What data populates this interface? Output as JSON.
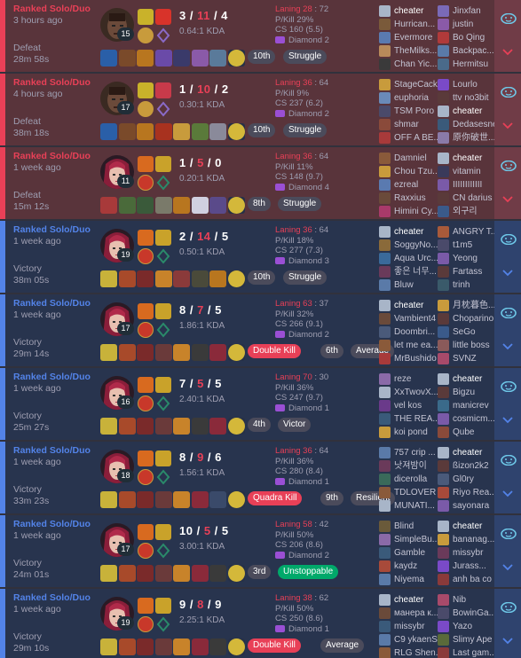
{
  "colors": {
    "loss": "#e84057",
    "win": "#5383e8",
    "loss_bg": "#59343b",
    "win_bg": "#28344e"
  },
  "games": [
    {
      "result": "loss",
      "queue": "Ranked Solo/Duo",
      "ago": "3 hours ago",
      "outcome": "Defeat",
      "duration": "28m 58s",
      "level": "15",
      "kills": "3",
      "deaths": "11",
      "assists": "4",
      "kda": "0.64:1 KDA",
      "champ": "dark",
      "laning": "Laning 28",
      "laning_opp": " : 72",
      "pkill": "P/Kill 29%",
      "cs": "CS 160 (5.5)",
      "rank": "Diamond 2",
      "placement": "10th",
      "chips": [
        {
          "text": "Struggle",
          "type": "tag"
        }
      ],
      "items": [
        "#2a5fa8",
        "#7a4a2a",
        "#b8761f",
        "#6a4aa8",
        "#3a3a6a",
        "#8a5aa8",
        "#5a7a9a",
        "#2a2a3a"
      ],
      "ward": "#d4b83a",
      "spells": [
        "#c9b22a",
        "#d8332a"
      ],
      "runes": [
        "#c89b3c",
        "#8a6ac8"
      ],
      "blue": [
        {
          "name": "cheater",
          "icon": "#a8b5c8"
        },
        {
          "name": "Hurrican...",
          "icon": "#7a5a3a"
        },
        {
          "name": "Evermore",
          "icon": "#5a7ab0"
        },
        {
          "name": "TheMilks...",
          "icon": "#b88a5a"
        },
        {
          "name": "Chan Yic...",
          "icon": "#3a3a3a"
        }
      ],
      "red": [
        {
          "name": "Jinxfan",
          "icon": "#7a6ab8"
        },
        {
          "name": "justin",
          "icon": "#8a5aa8"
        },
        {
          "name": "Bo Qing",
          "icon": "#b03a3a"
        },
        {
          "name": "Backpac...",
          "icon": "#5a7aa8"
        },
        {
          "name": "Hermitsu",
          "icon": "#4a6a8a"
        }
      ]
    },
    {
      "result": "loss",
      "queue": "Ranked Solo/Duo",
      "ago": "4 hours ago",
      "outcome": "Defeat",
      "duration": "38m 18s",
      "level": "17",
      "kills": "1",
      "deaths": "10",
      "assists": "2",
      "kda": "0.30:1 KDA",
      "champ": "dark",
      "laning": "Laning 36",
      "laning_opp": " : 64",
      "pkill": "P/Kill 9%",
      "cs": "CS 237 (6.2)",
      "rank": "Diamond 2",
      "placement": "10th",
      "chips": [
        {
          "text": "Struggle",
          "type": "tag"
        }
      ],
      "items": [
        "#2a5fa8",
        "#7a4a2a",
        "#b8761f",
        "#a8321f",
        "#c89b3c",
        "#5a7a3a",
        "#8a8a9a",
        "#2a2a3a"
      ],
      "ward": "#d4b83a",
      "spells": [
        "#c9b22a",
        "#c83a4a"
      ],
      "runes": [
        "#c89b3c",
        "#8a6ac8"
      ],
      "blue": [
        {
          "name": "StageCack",
          "icon": "#c89b3c"
        },
        {
          "name": "euphoria",
          "icon": "#6a8ab8"
        },
        {
          "name": "TSM Poro",
          "icon": "#4a4a6a"
        },
        {
          "name": "shmar",
          "icon": "#8a4a3a"
        },
        {
          "name": "OFF A BE...",
          "icon": "#a83a3a"
        }
      ],
      "red": [
        {
          "name": "Lourlo",
          "icon": "#7a4ac8"
        },
        {
          "name": "ttv no3bit",
          "icon": "#5a3a3a"
        },
        {
          "name": "cheater",
          "icon": "#a8b5c8"
        },
        {
          "name": "Dedasesne",
          "icon": "#3a5a7a"
        },
        {
          "name": "原你破世...",
          "icon": "#8a7aa8"
        }
      ]
    },
    {
      "result": "loss",
      "queue": "Ranked Solo/Duo",
      "ago": "1 week ago",
      "outcome": "Defeat",
      "duration": "15m 12s",
      "level": "11",
      "kills": "1",
      "deaths": "5",
      "assists": "0",
      "kda": "0.20:1 KDA",
      "champ": "pink",
      "laning": "Laning 36",
      "laning_opp": " : 64",
      "pkill": "P/Kill 11%",
      "cs": "CS 148 (9.7)",
      "rank": "Diamond 4",
      "placement": "8th",
      "chips": [
        {
          "text": "Struggle",
          "type": "tag"
        }
      ],
      "items": [
        "#a83a3a",
        "#4a6a3a",
        "#3a5a3a",
        "#7a7a6a",
        "#b8761f",
        "#d0d0e0",
        "#5a4a8a",
        "#2a2a3a"
      ],
      "ward": "#d4b83a",
      "spells": [
        "#d86a1f",
        "#c9a22a"
      ],
      "runes": [
        "#c8382a",
        "#2a8a6a"
      ],
      "blue": [
        {
          "name": "Damniel",
          "icon": "#8a5a3a"
        },
        {
          "name": "Chou Tzu...",
          "icon": "#c89b3c"
        },
        {
          "name": "ezreal",
          "icon": "#5a7ab0"
        },
        {
          "name": "Raxxius",
          "icon": "#6a4a3a"
        },
        {
          "name": "Himini Cy...",
          "icon": "#a83a6a"
        }
      ],
      "red": [
        {
          "name": "cheater",
          "icon": "#a8b5c8"
        },
        {
          "name": "vitamin",
          "icon": "#3a3a5a"
        },
        {
          "name": "IIIIIIIIIIII",
          "icon": "#7a5aa8"
        },
        {
          "name": "CN darius",
          "icon": "#5a3a3a"
        },
        {
          "name": "외구리",
          "icon": "#3a5a8a"
        }
      ]
    },
    {
      "result": "win",
      "queue": "Ranked Solo/Duo",
      "ago": "1 week ago",
      "outcome": "Victory",
      "duration": "38m 05s",
      "level": "19",
      "kills": "2",
      "deaths": "14",
      "assists": "5",
      "kda": "0.50:1 KDA",
      "champ": "pink",
      "laning": "Laning 36",
      "laning_opp": " : 64",
      "pkill": "P/Kill 18%",
      "cs": "CS 277 (7.3)",
      "rank": "Diamond 3",
      "placement": "10th",
      "chips": [
        {
          "text": "Struggle",
          "type": "tag"
        }
      ],
      "items": [
        "#c8b23a",
        "#a84a2a",
        "#7a2a2a",
        "#c8832a",
        "#8a3a3a",
        "#4a4a3a",
        "#b8761f",
        "#2a2a3a"
      ],
      "ward": "#d4b83a",
      "spells": [
        "#d86a1f",
        "#c9a22a"
      ],
      "runes": [
        "#c8382a",
        "#2a8a6a"
      ],
      "blue": [
        {
          "name": "cheater",
          "icon": "#a8b5c8"
        },
        {
          "name": "SoggyNo...",
          "icon": "#8a6a3a"
        },
        {
          "name": "Aqua Urc...",
          "icon": "#3a6a9a"
        },
        {
          "name": "좋은 너무...",
          "icon": "#6a3a5a"
        },
        {
          "name": "Bluw",
          "icon": "#5a7aa8"
        }
      ],
      "red": [
        {
          "name": "ANGRY T...",
          "icon": "#a85a3a"
        },
        {
          "name": "t1m5",
          "icon": "#4a4a6a"
        },
        {
          "name": "Yeong",
          "icon": "#7a5aa8"
        },
        {
          "name": "Fartass",
          "icon": "#5a3a3a"
        },
        {
          "name": "trinh",
          "icon": "#3a5a6a"
        }
      ]
    },
    {
      "result": "win",
      "queue": "Ranked Solo/Duo",
      "ago": "1 week ago",
      "outcome": "Victory",
      "duration": "29m 14s",
      "level": "17",
      "kills": "8",
      "deaths": "7",
      "assists": "5",
      "kda": "1.86:1 KDA",
      "champ": "pink",
      "laning": "Laning 63",
      "laning_opp": " : 37",
      "pkill": "P/Kill 32%",
      "cs": "CS 266 (9.1)",
      "rank": "Diamond 2",
      "placement": "6th",
      "chips": [
        {
          "text": "Double Kill",
          "type": "kill"
        },
        {
          "text": "Average",
          "type": "tag"
        }
      ],
      "items": [
        "#c8b23a",
        "#a84a2a",
        "#7a2a2a",
        "#6a3a3a",
        "#c8832a",
        "#3a3a3a",
        "#8a2a3a",
        "#2a2a3a"
      ],
      "ward": "#d4b83a",
      "spells": [
        "#d86a1f",
        "#c9a22a"
      ],
      "runes": [
        "#c8382a",
        "#2a8a6a"
      ],
      "blue": [
        {
          "name": "cheater",
          "icon": "#a8b5c8"
        },
        {
          "name": "Vambient4",
          "icon": "#6a4a3a"
        },
        {
          "name": "Doombri...",
          "icon": "#4a5a7a"
        },
        {
          "name": "let me ea...",
          "icon": "#8a5a3a"
        },
        {
          "name": "MrBushido",
          "icon": "#a83a3a"
        }
      ],
      "red": [
        {
          "name": "月枕暮色...",
          "icon": "#c89b3c"
        },
        {
          "name": "Choparino",
          "icon": "#5a3a3a"
        },
        {
          "name": "SeGo",
          "icon": "#3a5a8a"
        },
        {
          "name": "little boss",
          "icon": "#8a5a5a"
        },
        {
          "name": "SVNZ",
          "icon": "#a84a6a"
        }
      ]
    },
    {
      "result": "win",
      "queue": "Ranked Solo/Duo",
      "ago": "1 week ago",
      "outcome": "Victory",
      "duration": "25m 27s",
      "level": "16",
      "kills": "7",
      "deaths": "5",
      "assists": "5",
      "kda": "2.40:1 KDA",
      "champ": "pink",
      "laning": "Laning 70",
      "laning_opp": " : 30",
      "pkill": "P/Kill 36%",
      "cs": "CS 247 (9.7)",
      "rank": "Diamond 1",
      "placement": "4th",
      "chips": [
        {
          "text": "Victor",
          "type": "tag"
        }
      ],
      "items": [
        "#c8b23a",
        "#a84a2a",
        "#7a2a2a",
        "#6a3a3a",
        "#c8832a",
        "#3a3a3a",
        "#8a2a3a",
        "#2a2a3a"
      ],
      "ward": "#d4b83a",
      "spells": [
        "#d86a1f",
        "#c9a22a"
      ],
      "runes": [
        "#c8382a",
        "#2a8a6a"
      ],
      "blue": [
        {
          "name": "reze",
          "icon": "#8a6aa8"
        },
        {
          "name": "XxTwovX...",
          "icon": "#a8b5c8"
        },
        {
          "name": "vel kos",
          "icon": "#6a3a8a"
        },
        {
          "name": "THE REA...",
          "icon": "#3a5a7a"
        },
        {
          "name": "koi pond",
          "icon": "#c89b3c"
        }
      ],
      "red": [
        {
          "name": "cheater",
          "icon": "#a8b5c8"
        },
        {
          "name": "Bigzu",
          "icon": "#5a3a3a"
        },
        {
          "name": "manicrev",
          "icon": "#3a6a8a"
        },
        {
          "name": "cosmicm...",
          "icon": "#7a5aa8"
        },
        {
          "name": "Qube",
          "icon": "#8a4a3a"
        }
      ]
    },
    {
      "result": "win",
      "queue": "Ranked Solo/Duo",
      "ago": "1 week ago",
      "outcome": "Victory",
      "duration": "33m 23s",
      "level": "18",
      "kills": "8",
      "deaths": "9",
      "assists": "6",
      "kda": "1.56:1 KDA",
      "champ": "pink",
      "laning": "Laning 36",
      "laning_opp": " : 64",
      "pkill": "P/Kill 36%",
      "cs": "CS 280 (8.4)",
      "rank": "Diamond 1",
      "placement": "9th",
      "chips": [
        {
          "text": "Quadra Kill",
          "type": "kill"
        },
        {
          "text": "Resilient",
          "type": "tag"
        }
      ],
      "items": [
        "#c8b23a",
        "#a84a2a",
        "#7a2a2a",
        "#6a3a3a",
        "#c8832a",
        "#8a2a3a",
        "#3a4a6a",
        "#2a2a3a"
      ],
      "ward": "#d4b83a",
      "spells": [
        "#d86a1f",
        "#c9a22a"
      ],
      "runes": [
        "#c8382a",
        "#2a8a6a"
      ],
      "blue": [
        {
          "name": "757 crip ...",
          "icon": "#5a7aa8"
        },
        {
          "name": "낫져밤이",
          "icon": "#6a3a5a"
        },
        {
          "name": "dicerolla",
          "icon": "#3a6a5a"
        },
        {
          "name": "TDLOVER",
          "icon": "#8a5a3a"
        },
        {
          "name": "MUNATI...",
          "icon": "#a8b5c8"
        }
      ],
      "red": [
        {
          "name": "cheater",
          "icon": "#a8b5c8"
        },
        {
          "name": "ßizon2k2",
          "icon": "#5a3a3a"
        },
        {
          "name": "Gl0ry",
          "icon": "#4a5a7a"
        },
        {
          "name": "Riyo Rea...",
          "icon": "#a84a3a"
        },
        {
          "name": "sayonara",
          "icon": "#7a5aa8"
        }
      ]
    },
    {
      "result": "win",
      "queue": "Ranked Solo/Duo",
      "ago": "1 week ago",
      "outcome": "Victory",
      "duration": "24m 01s",
      "level": "17",
      "kills": "10",
      "deaths": "5",
      "assists": "5",
      "kda": "3.00:1 KDA",
      "champ": "pink",
      "laning": "Laning 58",
      "laning_opp": " : 42",
      "pkill": "P/Kill 50%",
      "cs": "CS 206 (8.6)",
      "rank": "Diamond 2",
      "placement": "3rd",
      "chips": [
        {
          "text": "Unstoppable",
          "type": "good"
        }
      ],
      "items": [
        "#c8b23a",
        "#a84a2a",
        "#7a2a2a",
        "#6a3a3a",
        "#c8832a",
        "#8a2a3a",
        "#3a3a3a",
        "#2a2a3a"
      ],
      "ward": "#d4b83a",
      "spells": [
        "#d86a1f",
        "#c9a22a"
      ],
      "runes": [
        "#c8382a",
        "#2a8a6a"
      ],
      "blue": [
        {
          "name": "Blind",
          "icon": "#6a5a3a"
        },
        {
          "name": "SimpleBu...",
          "icon": "#8a6aa8"
        },
        {
          "name": "Gamble",
          "icon": "#3a5a7a"
        },
        {
          "name": "kaydz",
          "icon": "#a84a3a"
        },
        {
          "name": "Niyema",
          "icon": "#5a7aa8"
        }
      ],
      "red": [
        {
          "name": "cheater",
          "icon": "#a8b5c8"
        },
        {
          "name": "bananag...",
          "icon": "#c89b3c"
        },
        {
          "name": "missybr",
          "icon": "#6a3a5a"
        },
        {
          "name": "Jurass...",
          "icon": "#7a4ac8"
        },
        {
          "name": "anh ba co",
          "icon": "#8a3a3a"
        }
      ]
    },
    {
      "result": "win",
      "queue": "Ranked Solo/Duo",
      "ago": "1 week ago",
      "outcome": "Victory",
      "duration": "29m 10s",
      "level": "19",
      "kills": "9",
      "deaths": "8",
      "assists": "9",
      "kda": "2.25:1 KDA",
      "champ": "pink",
      "laning": "Laning 38",
      "laning_opp": " : 62",
      "pkill": "P/Kill 50%",
      "cs": "CS 250 (8.6)",
      "rank": "Diamond 1",
      "placement": "",
      "chips": [
        {
          "text": "Double Kill",
          "type": "kill"
        },
        {
          "text": "Average",
          "type": "tag"
        }
      ],
      "items": [
        "#c8b23a",
        "#a84a2a",
        "#7a2a2a",
        "#6a3a3a",
        "#c8832a",
        "#8a2a3a",
        "#3a3a3a",
        "#2a2a3a"
      ],
      "ward": "#d4b83a",
      "spells": [
        "#d86a1f",
        "#c9a22a"
      ],
      "runes": [
        "#c8382a",
        "#2a8a6a"
      ],
      "blue": [
        {
          "name": "cheater",
          "icon": "#a8b5c8"
        },
        {
          "name": "манера к...",
          "icon": "#6a4a3a"
        },
        {
          "name": "missybr",
          "icon": "#3a5a7a"
        },
        {
          "name": "C9 ykaenS",
          "icon": "#5a7aa8"
        },
        {
          "name": "RLG Shen...",
          "icon": "#8a5a3a"
        }
      ],
      "red": [
        {
          "name": "Nib",
          "icon": "#a84a6a"
        },
        {
          "name": "BowinGa...",
          "icon": "#4a4a6a"
        },
        {
          "name": "Yazo",
          "icon": "#7a4ac8"
        },
        {
          "name": "Slimy Ape",
          "icon": "#5a6a3a"
        },
        {
          "name": "Last gam...",
          "icon": "#8a3a3a"
        }
      ]
    }
  ]
}
